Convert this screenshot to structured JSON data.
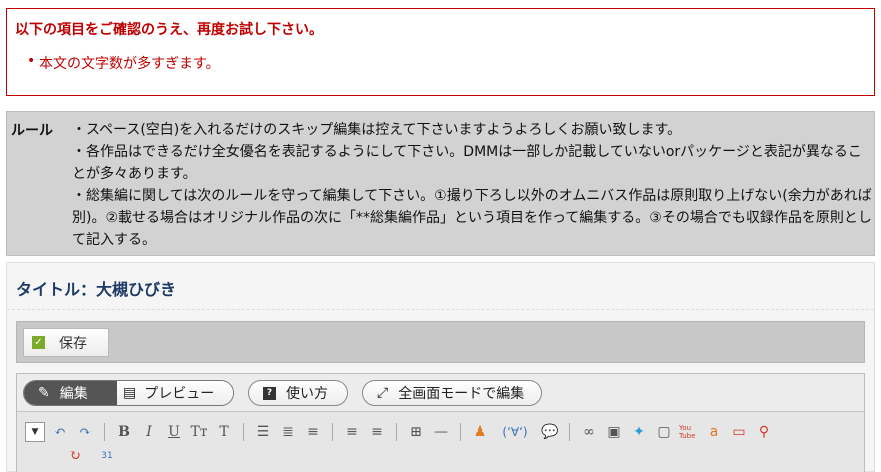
{
  "error": {
    "title": "以下の項目をご確認のうえ、再度お試し下さい。",
    "items": [
      "本文の文字数が多すぎます。"
    ]
  },
  "rules": {
    "label": "ルール",
    "lines": [
      "・スペース(空白)を入れるだけのスキップ編集は控えて下さいますようよろしくお願い致します。",
      "・各作品はできるだけ全女優名を表記するようにして下さい。DMMは一部しか記載していないorパッケージと表記が異なることが多々あります。",
      "・総集編に関しては次のルールを守って編集して下さい。①撮り下ろし以外のオムニバス作品は原則取り上げない(余力があれば別)。②載せる場合はオリジナル作品の次に「**総集編作品」という項目を作って編集する。③その場合でも収録作品を原則として記入する。"
    ]
  },
  "page": {
    "title": "タイトル：大槻ひびき"
  },
  "toolbar": {
    "save_label": "保存",
    "mode_edit": "編集",
    "mode_preview": "プレビュー",
    "help_label": "使い方",
    "fullscreen_label": "全画面モードで編集"
  },
  "format_buttons": {
    "bold": "B",
    "italic": "I",
    "underline": "U",
    "font_size": "Tт",
    "color": "T",
    "ddown": "▼",
    "face": "(ʻ∀ʻ)",
    "cal": "31",
    "youtube": "You Tube",
    "amazon": "a"
  },
  "colors": {
    "error_red": "#c00000",
    "rules_bg": "#d2d2d2",
    "title_blue": "#1d3a66",
    "save_green": "#7bab2a",
    "edit_dark": "#555555"
  }
}
